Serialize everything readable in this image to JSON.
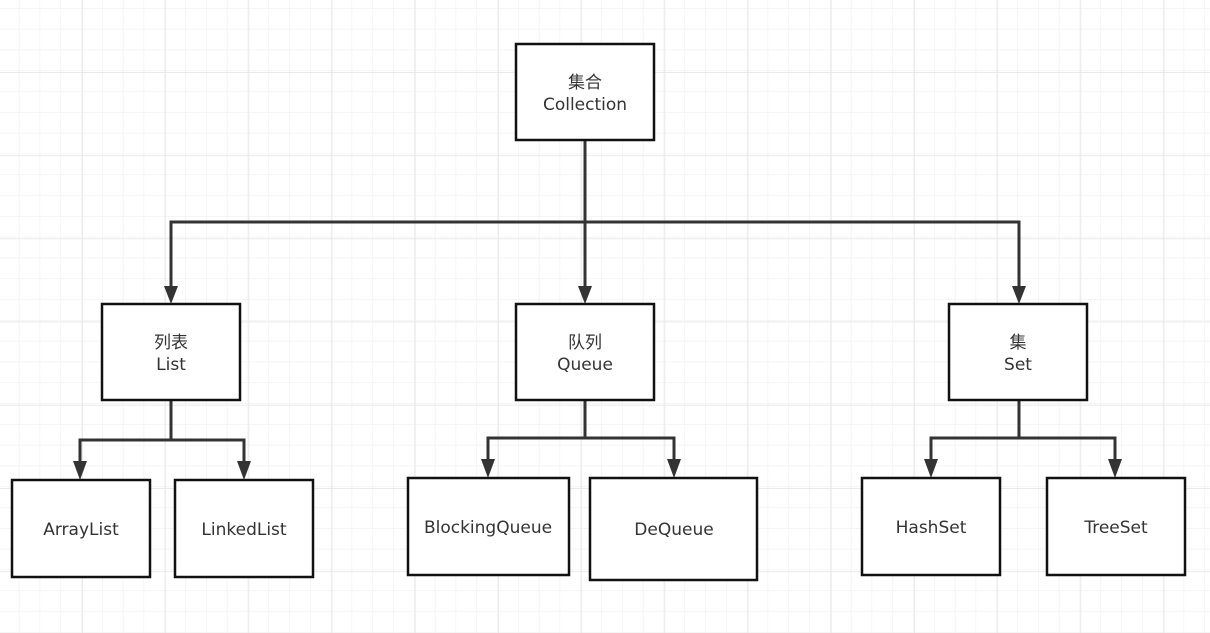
{
  "nodes": {
    "collection": {
      "line1": "集合",
      "line2": "Collection"
    },
    "list": {
      "line1": "列表",
      "line2": "List"
    },
    "queue": {
      "line1": "队列",
      "line2": "Queue"
    },
    "set": {
      "line1": "集",
      "line2": "Set"
    },
    "arraylist": {
      "label": "ArrayList"
    },
    "linkedlist": {
      "label": "LinkedList"
    },
    "blockingqueue": {
      "label": "BlockingQueue"
    },
    "dequeue": {
      "label": "DeQueue"
    },
    "hashset": {
      "label": "HashSet"
    },
    "treeset": {
      "label": "TreeSet"
    }
  },
  "colors": {
    "grid": "#ececec",
    "grid_major": "#e2e2e2",
    "stroke": "#111111",
    "edge": "#333333"
  }
}
